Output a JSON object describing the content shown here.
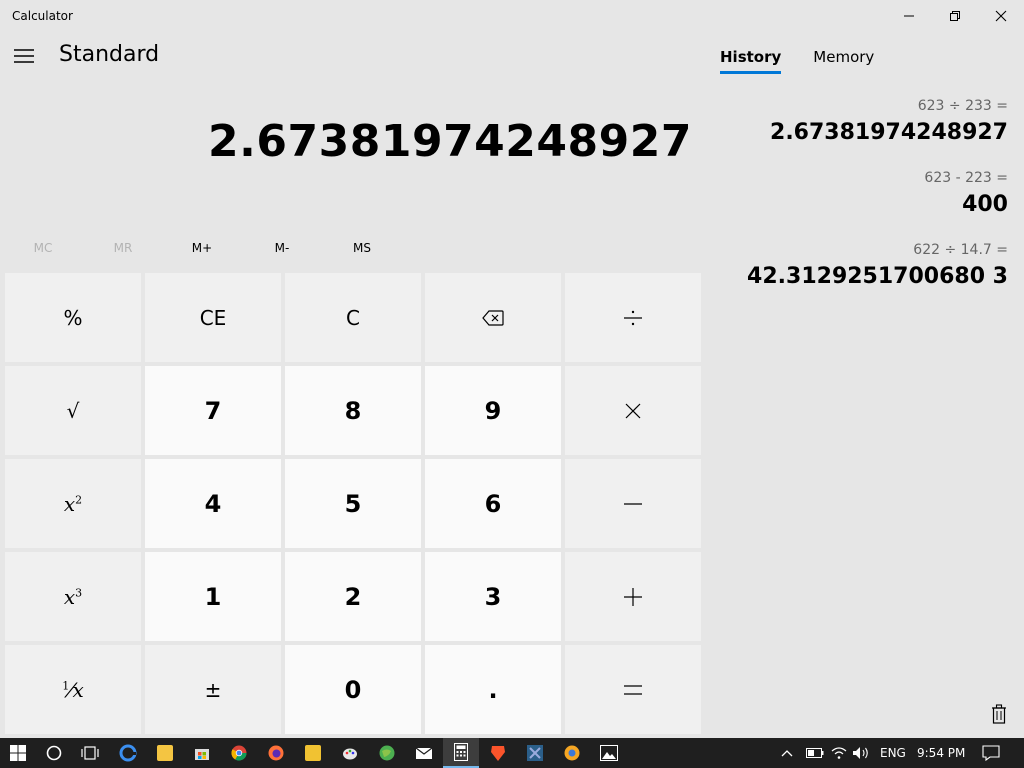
{
  "window": {
    "title": "Calculator"
  },
  "header": {
    "mode": "Standard"
  },
  "display": {
    "expression": "",
    "value": "2.67381974248927"
  },
  "memory": {
    "buttons": [
      "MC",
      "MR",
      "M+",
      "M-",
      "MS"
    ]
  },
  "keys": {
    "percent": "%",
    "ce": "CE",
    "c": "C",
    "sqrt": "√",
    "n7": "7",
    "n8": "8",
    "n9": "9",
    "n4": "4",
    "n5": "5",
    "n6": "6",
    "n1": "1",
    "n2": "2",
    "n3": "3",
    "negate": "±",
    "n0": "0",
    "decimal": ".",
    "square_base": "x",
    "square_exp": "2",
    "cube_base": "x",
    "cube_exp": "3",
    "reciprocal_num": "1",
    "reciprocal_den": "x"
  },
  "tabs": {
    "history": "History",
    "memory": "Memory"
  },
  "history": [
    {
      "expression": "623   ÷   233 =",
      "result": "2.67381974248927"
    },
    {
      "expression": "623   -   223 =",
      "result": "400"
    },
    {
      "expression": "622   ÷   14.7 =",
      "result": "42.3129251700680 3"
    }
  ],
  "tray": {
    "language": "ENG",
    "time": "9:54 PM"
  },
  "colors": {
    "accent": "#0078d7",
    "background": "#e6e6e6",
    "number_key": "#fafafa",
    "function_key": "#f0f0f0",
    "taskbar": "#1f1f1f"
  }
}
